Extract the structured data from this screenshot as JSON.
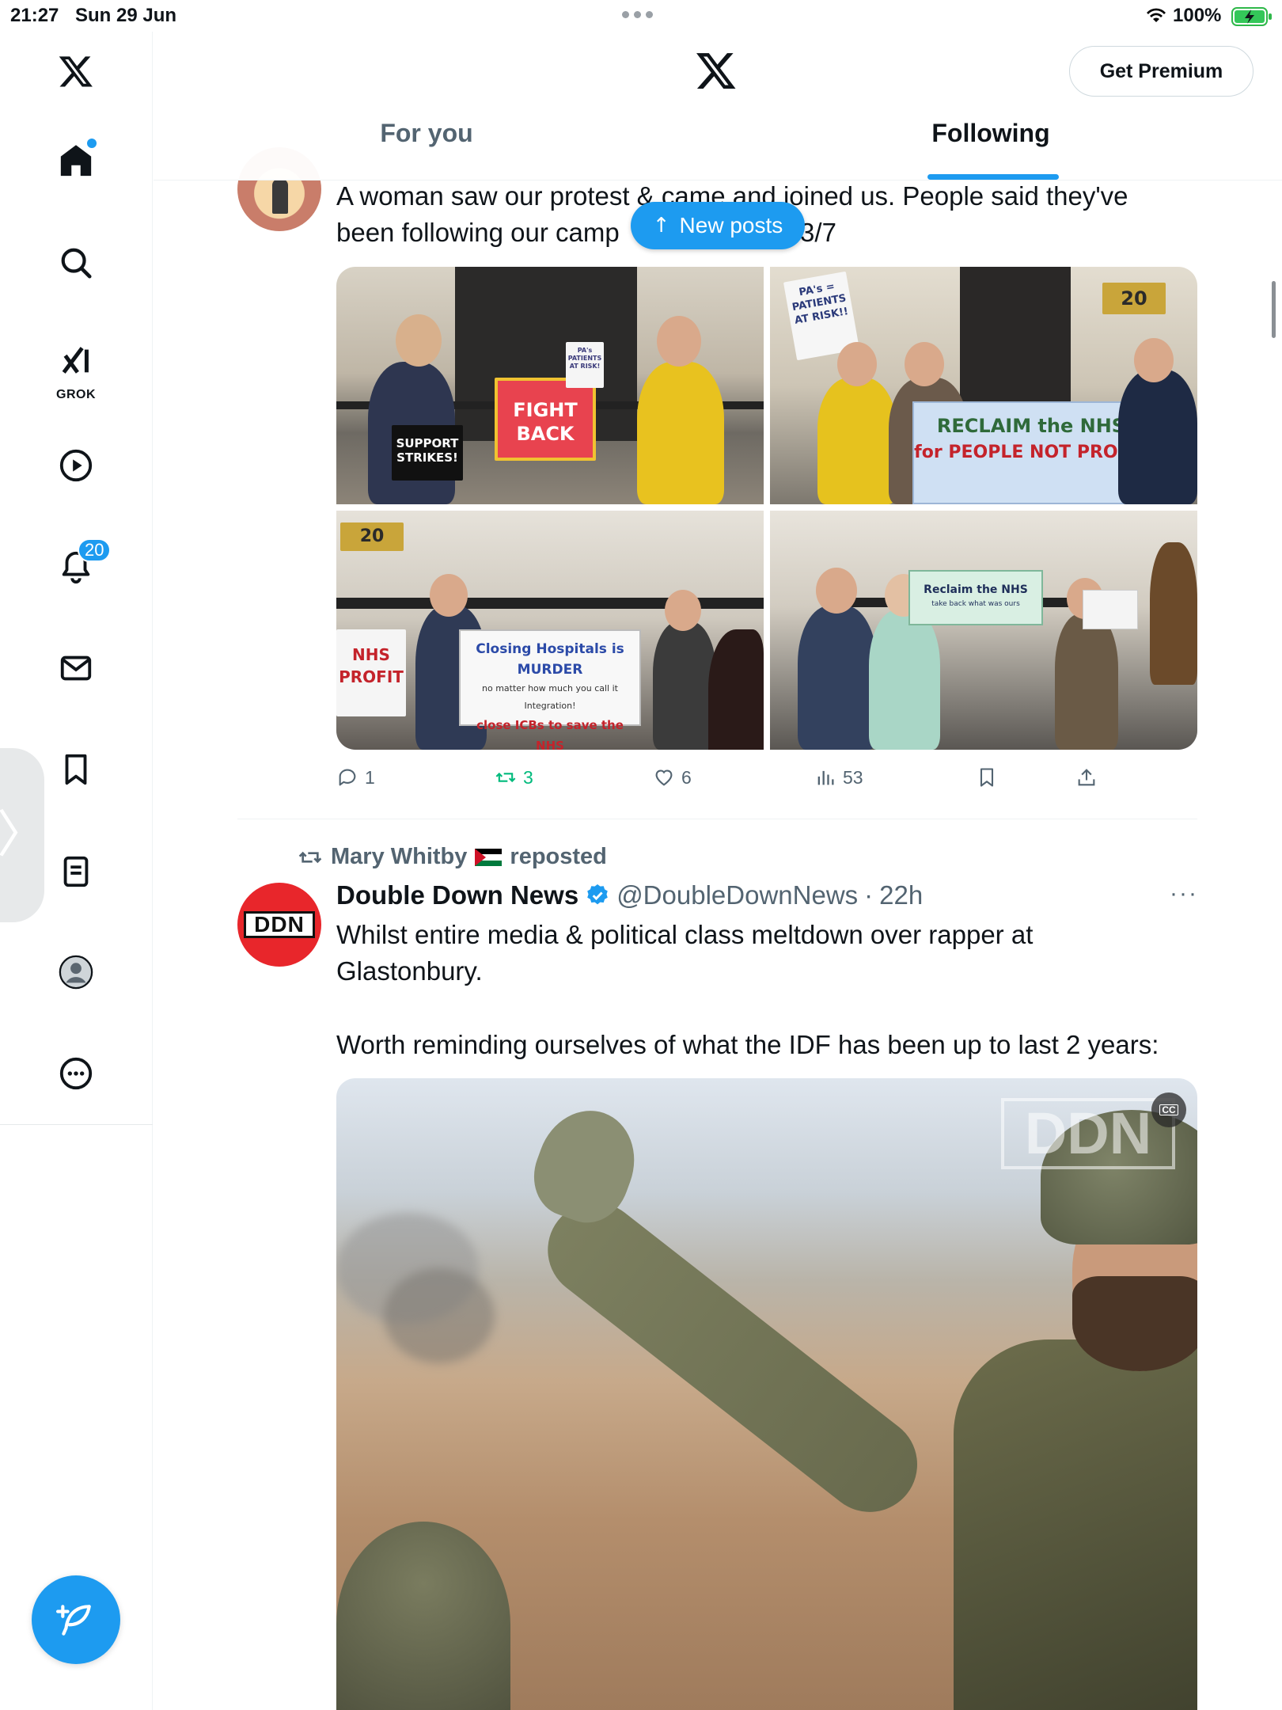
{
  "status_bar": {
    "time": "21:27",
    "date": "Sun 29 Jun",
    "battery": "100%"
  },
  "sidebar": {
    "items": [
      {
        "name": "x-logo-icon"
      },
      {
        "name": "home-icon"
      },
      {
        "name": "search-icon"
      },
      {
        "name": "grok-icon",
        "label": "GROK"
      },
      {
        "name": "video-play-icon"
      },
      {
        "name": "notifications-icon",
        "badge": "20"
      },
      {
        "name": "messages-icon"
      },
      {
        "name": "bookmarks-icon"
      },
      {
        "name": "lists-icon"
      },
      {
        "name": "profile-avatar-icon"
      },
      {
        "name": "more-icon"
      }
    ],
    "compose_icon": "compose-feather-icon"
  },
  "header": {
    "premium_label": "Get Premium",
    "tabs": [
      {
        "label": "For you",
        "active": false
      },
      {
        "label": "Following",
        "active": true
      }
    ]
  },
  "new_posts_label": "New posts",
  "tweet1": {
    "text_line1": "A woman saw our protest & came and joined us. People said they've",
    "text_line2_start": "been following our camp",
    "text_line2_end": ". 3/7",
    "images": {
      "p1": {
        "sign1": "FIGHT BACK",
        "sign2": "PA's PATIENTS AT RISK!",
        "bag": "SUPPORT STRIKES!"
      },
      "p2": {
        "sign1": "PA's = PATIENTS AT RISK!!",
        "sign2_l1": "RECLAIM the NHS",
        "sign2_l2": "for PEOPLE NOT PROFIT",
        "num": "20"
      },
      "p3": {
        "sign1_l1": "Closing Hospitals is MURDER",
        "sign1_l2": "no matter how much you call it Integration!",
        "sign1_l3": "close ICBs to save the NHS",
        "sign2": "NHS PROFIT",
        "num": "20"
      },
      "p4": {
        "sign1_l1": "Reclaim the NHS",
        "sign1_l2": "take back what was ours"
      }
    },
    "actions": {
      "replies": "1",
      "reposts": "3",
      "likes": "6",
      "views": "53"
    }
  },
  "tweet2": {
    "repost_by": "Mary Whitby",
    "repost_label": "reposted",
    "author": "Double Down News",
    "handle": "@DoubleDownNews",
    "dot": "·",
    "time": "22h",
    "avatar_text": "DDN",
    "more": "···",
    "text1_l1": "Whilst entire media & political class meltdown over rapper at",
    "text1_l2": "Glastonbury.",
    "text2": "Worth reminding ourselves of what the IDF has been up to last 2 years:",
    "video_watermark": "DDN",
    "cc": "CC"
  },
  "colors": {
    "accent": "#1d9bf0",
    "text_primary": "#0f1419",
    "text_secondary": "#536471",
    "repost_green": "#00ba7c",
    "ddn_red": "#e8262b"
  }
}
